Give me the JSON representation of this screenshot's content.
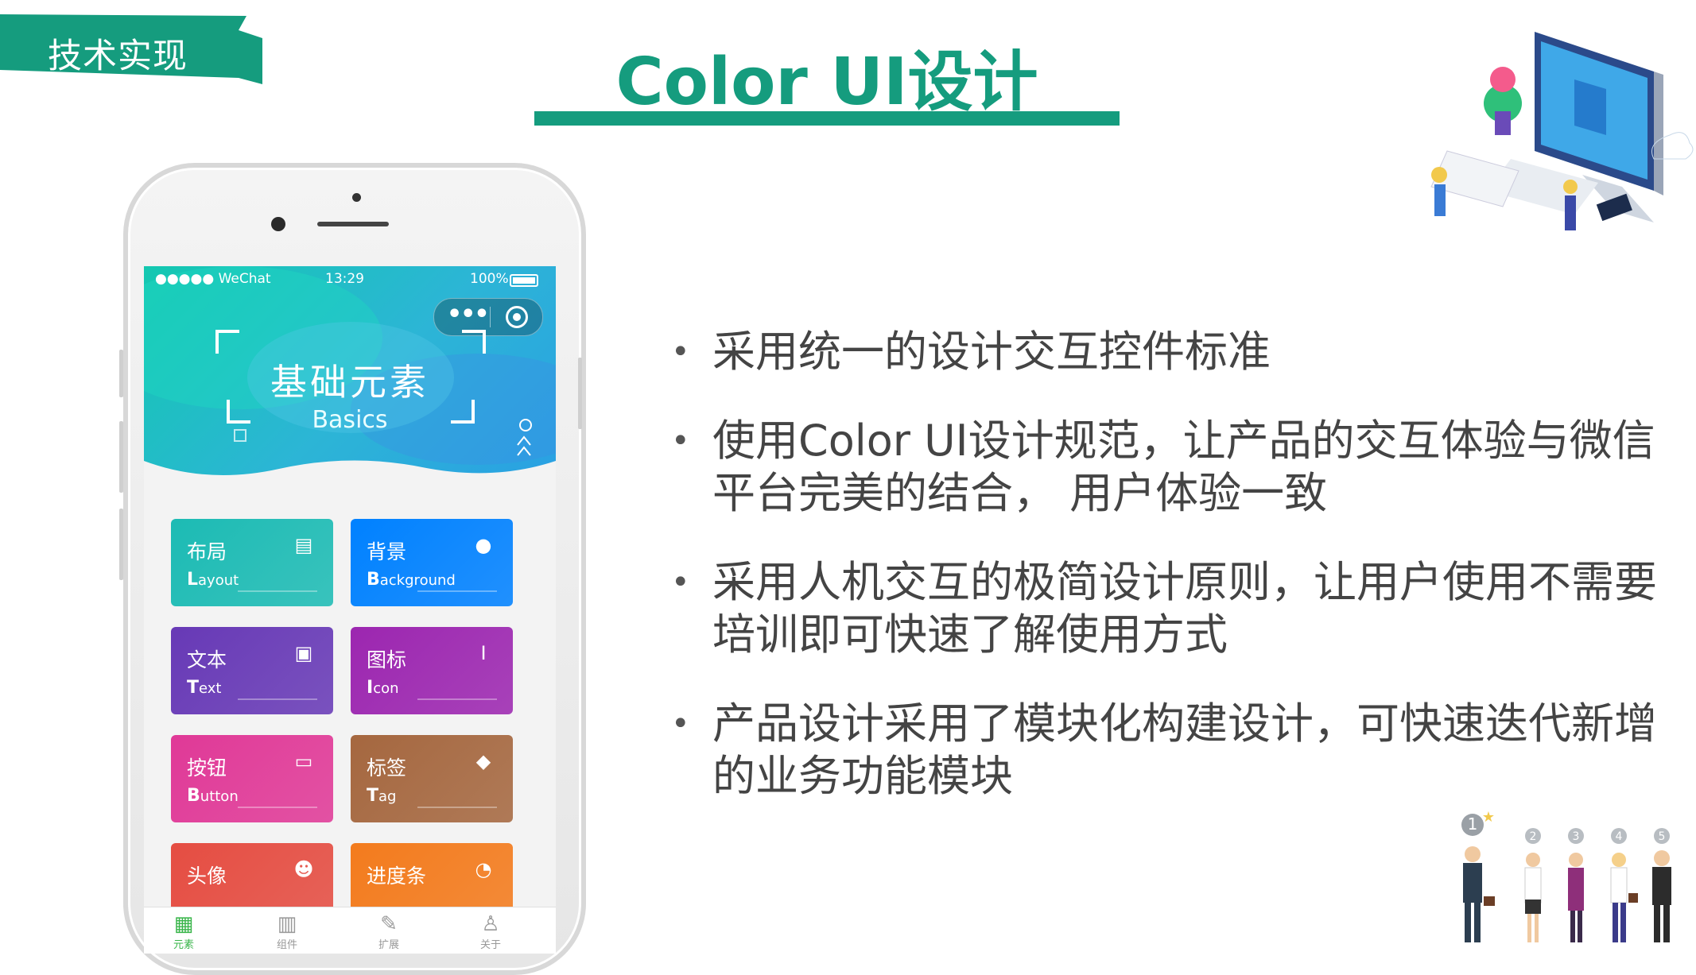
{
  "slide": {
    "section_tag": "技术实现",
    "title": "Color UI设计",
    "accent_color": "#159c7e",
    "bullets": [
      "采用统一的设计交互控件标准",
      "使用Color UI设计规范，让产品的交互体验与微信平台完美的结合， 用户体验一致",
      "采用人机交互的极简设计原则，让用户使用不需要培训即可快速了解使用方式",
      "产品设计采用了模块化构建设计，可快速迭代新增的业务功能模块"
    ]
  },
  "phone": {
    "status": {
      "carrier": "●●●●● WeChat",
      "time": "13:29",
      "battery": "100%"
    },
    "hero": {
      "title_cn": "基础元素",
      "title_en": "Basics"
    },
    "cards": [
      {
        "cn": "布局",
        "en_first": "L",
        "en_rest": "ayout",
        "icon": "layout-icon",
        "color": "#1cbbb4"
      },
      {
        "cn": "背景",
        "en_first": "B",
        "en_rest": "ackground",
        "icon": "palette-icon",
        "color": "#0081ff"
      },
      {
        "cn": "文本",
        "en_first": "T",
        "en_rest": "ext",
        "icon": "text-icon",
        "color": "#6739b6"
      },
      {
        "cn": "图标",
        "en_first": "I",
        "en_rest": "con",
        "icon": "icon-icon",
        "color": "#9c26b0"
      },
      {
        "cn": "按钮",
        "en_first": "B",
        "en_rest": "utton",
        "icon": "button-icon",
        "color": "#e03997"
      },
      {
        "cn": "标签",
        "en_first": "T",
        "en_rest": "ag",
        "icon": "tag-icon",
        "color": "#a5673f"
      },
      {
        "cn": "头像",
        "en_first": "",
        "en_rest": "",
        "icon": "avatar-icon",
        "color": "#e54d42"
      },
      {
        "cn": "进度条",
        "en_first": "",
        "en_rest": "",
        "icon": "progress-icon",
        "color": "#f37b1d"
      }
    ],
    "tabs": [
      {
        "label": "元素",
        "icon": "elements-icon",
        "active": true
      },
      {
        "label": "组件",
        "icon": "components-icon",
        "active": false
      },
      {
        "label": "扩展",
        "icon": "plugin-icon",
        "active": false
      },
      {
        "label": "关于",
        "icon": "about-icon",
        "active": false
      }
    ]
  },
  "ranking": [
    "1",
    "2",
    "3",
    "4",
    "5"
  ]
}
